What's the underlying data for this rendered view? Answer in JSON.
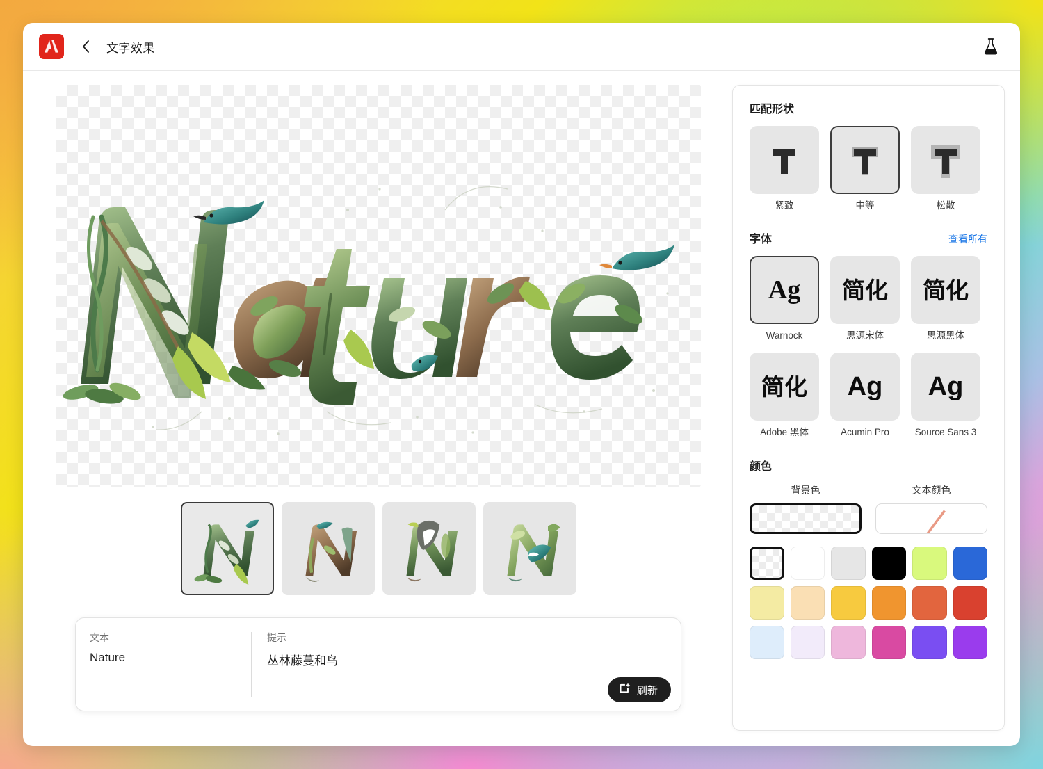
{
  "header": {
    "logo_icon": "adobe-logo-icon",
    "back_icon": "chevron-left-icon",
    "title": "文字效果",
    "lab_icon": "beaker-icon"
  },
  "canvas": {
    "artwork_text": "Nature",
    "background": "transparent-checkerboard"
  },
  "variants": [
    {
      "letter": "N",
      "selected": true
    },
    {
      "letter": "N",
      "selected": false
    },
    {
      "letter": "N",
      "selected": false
    },
    {
      "letter": "N",
      "selected": false
    }
  ],
  "prompt_bar": {
    "text_label": "文本",
    "text_value": "Nature",
    "prompt_label": "提示",
    "prompt_value": "丛林藤蔓和鸟",
    "refresh_label": "刷新",
    "refresh_icon": "sparkle-refresh-icon"
  },
  "panel": {
    "match_shape": {
      "title": "匹配形状",
      "options": [
        {
          "label": "紧致",
          "icon": "letter-t-tight-icon",
          "selected": false,
          "outline": 0
        },
        {
          "label": "中等",
          "icon": "letter-t-medium-icon",
          "selected": true,
          "outline": 1
        },
        {
          "label": "松散",
          "icon": "letter-t-loose-icon",
          "selected": false,
          "outline": 2
        }
      ]
    },
    "fonts": {
      "title": "字体",
      "view_all": "查看所有",
      "items": [
        {
          "label": "Warnock",
          "glyph": "Ag",
          "style": "serif",
          "selected": true
        },
        {
          "label": "思源宋体",
          "glyph": "简化",
          "style": "cjk-serif",
          "selected": false
        },
        {
          "label": "思源黑体",
          "glyph": "简化",
          "style": "cjk-sans",
          "selected": false
        },
        {
          "label": "Adobe 黑体",
          "glyph": "简化",
          "style": "cjk-sans-light",
          "selected": false
        },
        {
          "label": "Acumin Pro",
          "glyph": "Ag",
          "style": "sans",
          "selected": false
        },
        {
          "label": "Source Sans 3",
          "glyph": "Ag",
          "style": "sans",
          "selected": false
        }
      ]
    },
    "colors": {
      "title": "颜色",
      "background_label": "背景色",
      "background_value": "transparent",
      "background_selected": true,
      "text_color_label": "文本颜色",
      "text_color_value": "none",
      "swatches": [
        {
          "name": "transparent",
          "hex": "transparent",
          "selected": true
        },
        {
          "name": "white",
          "hex": "#ffffff",
          "selected": false
        },
        {
          "name": "light-gray",
          "hex": "#e6e6e6",
          "selected": false
        },
        {
          "name": "black",
          "hex": "#000000",
          "selected": false
        },
        {
          "name": "lime",
          "hex": "#d9f97d",
          "selected": false
        },
        {
          "name": "blue",
          "hex": "#2a68d8",
          "selected": false
        },
        {
          "name": "pale-yellow",
          "hex": "#f4eba3",
          "selected": false
        },
        {
          "name": "peach",
          "hex": "#fadfb4",
          "selected": false
        },
        {
          "name": "amber",
          "hex": "#f7ca3f",
          "selected": false
        },
        {
          "name": "orange",
          "hex": "#f0952f",
          "selected": false
        },
        {
          "name": "coral",
          "hex": "#e2653e",
          "selected": false
        },
        {
          "name": "red",
          "hex": "#d9412f",
          "selected": false
        },
        {
          "name": "pale-blue",
          "hex": "#deedfb",
          "selected": false
        },
        {
          "name": "pale-lavender",
          "hex": "#f2ebfa",
          "selected": false
        },
        {
          "name": "pink",
          "hex": "#eeb7dc",
          "selected": false
        },
        {
          "name": "magenta",
          "hex": "#d94aa2",
          "selected": false
        },
        {
          "name": "indigo",
          "hex": "#7a4ef2",
          "selected": false
        },
        {
          "name": "violet",
          "hex": "#9a3ced",
          "selected": false
        }
      ]
    }
  }
}
